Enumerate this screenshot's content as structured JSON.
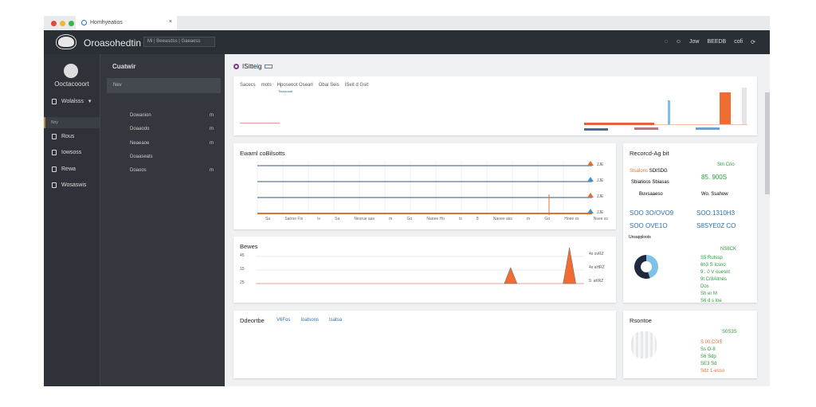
{
  "browser": {
    "tab_title": "Homhyeatios",
    "close": "×"
  },
  "header": {
    "brand": "Oroasohedtin",
    "search": "Mi | Beeasdss | Gaeaess",
    "actions": [
      "Jow",
      "BEEDB",
      "cofi"
    ]
  },
  "sidebar": {
    "user": "Ooctacooort",
    "items": [
      {
        "label": "Wolalsss",
        "caret": "▾"
      },
      {
        "label": "Rous"
      },
      {
        "label": "Iowsoss"
      },
      {
        "label": "Rewa"
      },
      {
        "label": "Wosaswis"
      }
    ],
    "selected": "Noy"
  },
  "subpanel": {
    "title": "Cuatwir",
    "search": "Nev",
    "items": [
      {
        "label": "Dowanion",
        "badge": "m"
      },
      {
        "label": "Doaaodo",
        "badge": "m"
      },
      {
        "label": "Neaeaoe",
        "badge": "m"
      },
      {
        "label": "Doaaseats",
        "badge": ""
      },
      {
        "label": "Doaoos",
        "badge": "m"
      }
    ]
  },
  "page": {
    "title": "ISitteig"
  },
  "summary": {
    "labels": [
      "Sacecs",
      "mots",
      "Hposeoot Osearl",
      "Obai Sels",
      "ISeit d Gsit"
    ],
    "sub": "Tssaaoaat"
  },
  "trend": {
    "title": "Ewaml coBilsotts",
    "right_labels": [
      "JJE",
      "JJE",
      "JJE",
      "JJE"
    ],
    "x_labels": [
      "Sa",
      "Satroe Fis",
      "is",
      "Sa",
      "Nesrue aas",
      "m",
      "Go",
      "Naoee Ho",
      "is",
      "8",
      "Naoee ass",
      "m",
      "Go",
      "Hoee ss",
      "Nsee ss"
    ],
    "lines": [
      {
        "color": "#5b7a98"
      },
      {
        "color": "#5b7a98"
      },
      {
        "color": "#5b7a98"
      },
      {
        "color": "#e0702f"
      }
    ]
  },
  "records": {
    "title": "Recorcd-Ag bit",
    "row1_label": "Stsalons",
    "row1_a": "SDISDG",
    "row1_b": "Stn Crio",
    "row1_val": "85. 900S",
    "row2_label": "Sbiatioos Sbiasas",
    "row3_a": "Buvsaaeso",
    "row3_b": "Wo. Ssahow",
    "stats": [
      "SOO 3O/OVO9",
      "SOO.1310H3",
      "SOO OVE1O",
      "S8SYE0Z CO"
    ],
    "legend_title": "Unsapploots",
    "legend_head": "NS6CK",
    "legend": [
      "S5 Rutssp",
      "6h3 S Icsno",
      "9:. 0 V ouesnt",
      "9t Cr8Aitnes",
      "Dos",
      "Sh er M",
      "S6 d s loe"
    ],
    "pie": [
      {
        "value": 45,
        "color": "#7fc2e6"
      },
      {
        "value": 55,
        "color": "#1e2a3c"
      }
    ]
  },
  "events": {
    "title": "Bewes",
    "y_labels": [
      "45",
      "15",
      "25"
    ],
    "right_labels": [
      "4s ovRZ",
      "4s aHRZ",
      "9. aKRZ"
    ],
    "peaks": [
      {
        "position": 0.78,
        "height": 0.45
      },
      {
        "position": 0.96,
        "height": 1.0
      }
    ]
  },
  "desc": {
    "title": "Ddeortbe",
    "tabs": [
      "V6Fos",
      "Ioatsons",
      "Isatsa"
    ]
  },
  "reactor": {
    "title": "Rsontoe",
    "head": "S0S3S",
    "lines": [
      "S 00.C0IS",
      "Ss O-8",
      "S6 Sdp",
      "SE3 Sd",
      "Sdz 1-esso"
    ]
  }
}
